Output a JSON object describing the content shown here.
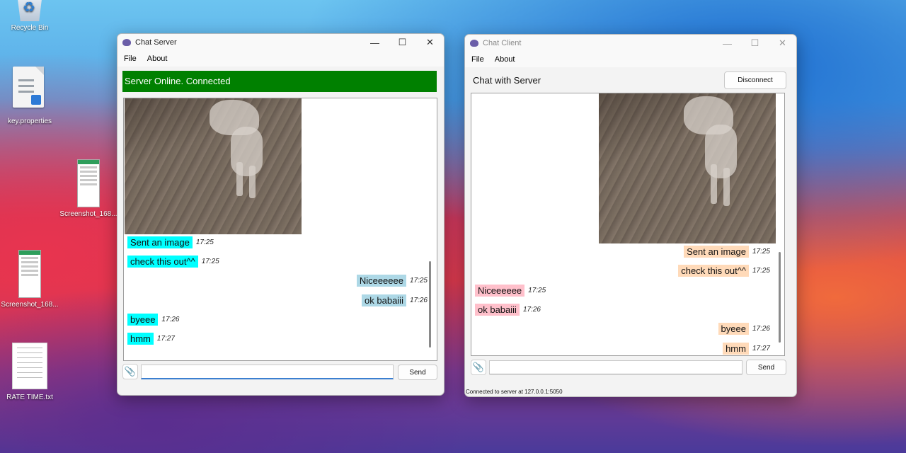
{
  "desktop": {
    "icons": [
      {
        "label": "Recycle Bin",
        "icon": "recycle-bin-icon"
      },
      {
        "label": "key.properties",
        "icon": "vscode-file-icon"
      },
      {
        "label": "Screenshot_168...",
        "icon": "image-file-icon"
      },
      {
        "label": "Screenshot_168...",
        "icon": "image-file-icon"
      },
      {
        "label": "RATE TIME.txt",
        "icon": "text-file-icon"
      }
    ]
  },
  "server": {
    "title": "Chat Server",
    "menu": [
      "File",
      "About"
    ],
    "status_banner": "Server Online. Connected",
    "status_color": "#008000",
    "messages": [
      {
        "text": "Sent an image",
        "time": "17:25",
        "side": "left",
        "color": "#00ffff"
      },
      {
        "text": "check this out^^",
        "time": "17:25",
        "side": "left",
        "color": "#00ffff"
      },
      {
        "text": "Niceeeeee",
        "time": "17:25",
        "side": "right",
        "color": "#add8e6"
      },
      {
        "text": "ok babaiii",
        "time": "17:26",
        "side": "right",
        "color": "#add8e6"
      },
      {
        "text": "byeee",
        "time": "17:26",
        "side": "left",
        "color": "#00ffff"
      },
      {
        "text": "hmm",
        "time": "17:27",
        "side": "left",
        "color": "#00ffff"
      }
    ],
    "input_value": "",
    "send_label": "Send"
  },
  "client": {
    "title": "Chat Client",
    "menu": [
      "File",
      "About"
    ],
    "header": "Chat with Server",
    "disconnect_label": "Disconnect",
    "messages": [
      {
        "text": "Sent an image",
        "time": "17:25",
        "side": "right",
        "color": "#ffdab9"
      },
      {
        "text": "check this out^^",
        "time": "17:25",
        "side": "right",
        "color": "#ffdab9"
      },
      {
        "text": "Niceeeeee",
        "time": "17:25",
        "side": "left",
        "color": "#ffc0cb"
      },
      {
        "text": "ok babaiii",
        "time": "17:26",
        "side": "left",
        "color": "#ffc0cb"
      },
      {
        "text": "byeee",
        "time": "17:26",
        "side": "right",
        "color": "#ffdab9"
      },
      {
        "text": "hmm",
        "time": "17:27",
        "side": "right",
        "color": "#ffdab9"
      }
    ],
    "input_value": "",
    "send_label": "Send",
    "statusbar": "Connected to server at 127.0.0.1:5050"
  }
}
